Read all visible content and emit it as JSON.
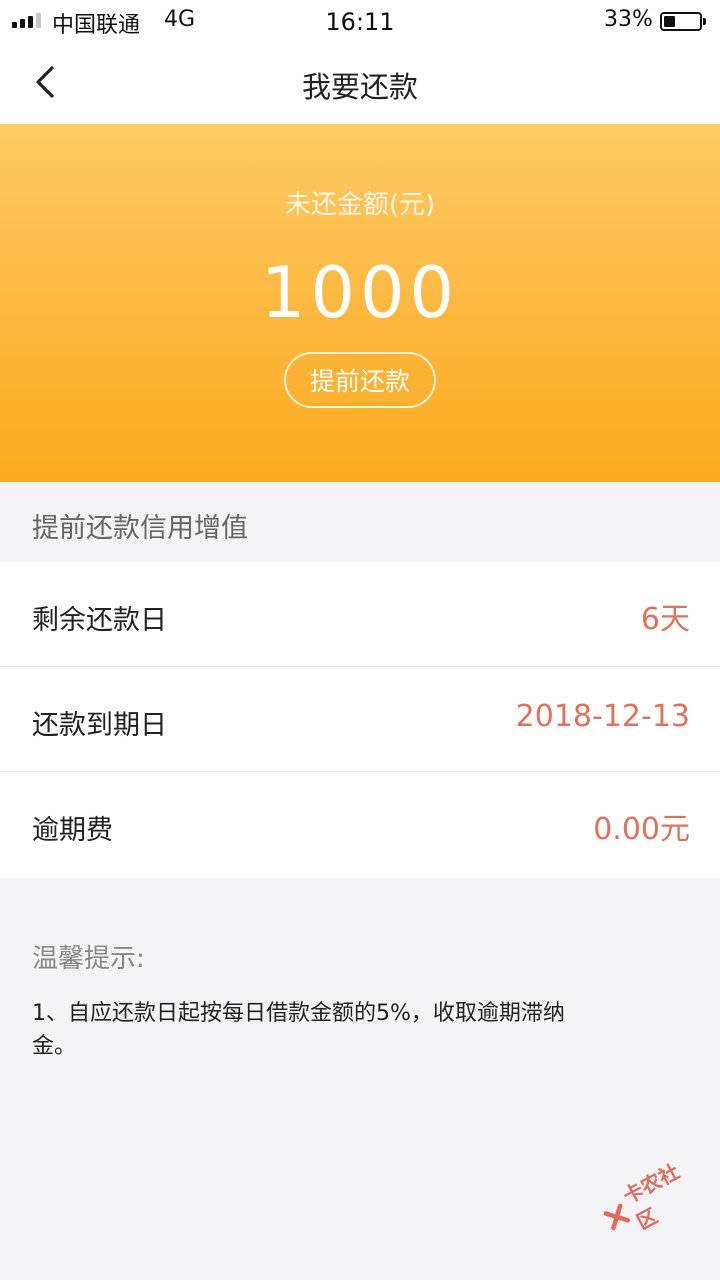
{
  "status_bar": {
    "carrier": "中国联通",
    "network": "4G",
    "time": "16:11",
    "battery_percent": "33%",
    "battery_level": 0.33
  },
  "nav": {
    "title": "我要还款",
    "back_icon": "chevron-left-icon"
  },
  "hero": {
    "label": "未还金额(元)",
    "amount": "1000",
    "prepay_button": "提前还款"
  },
  "section_header": "提前还款信用增值",
  "rows": [
    {
      "label": "剩余还款日",
      "value": "6天"
    },
    {
      "label": "还款到期日",
      "value": "2018-12-13"
    },
    {
      "label": "逾期费",
      "value": "0.00元"
    }
  ],
  "tips": {
    "title": "温馨提示:",
    "body": "1、自应还款日起按每日借款金额的5%，收取逾期滞纳金。"
  },
  "watermark": {
    "text": "卡农社区"
  },
  "colors": {
    "accent_value": "#e0715a",
    "hero_top": "#fdcb66",
    "hero_bottom": "#fbab20"
  }
}
